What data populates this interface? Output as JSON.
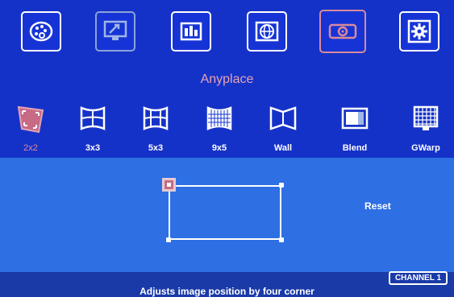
{
  "top_menu": {
    "items": [
      {
        "name": "palette-icon"
      },
      {
        "name": "display-settings-icon"
      },
      {
        "name": "layout-bars-icon"
      },
      {
        "name": "globe-icon"
      },
      {
        "name": "projector-icon",
        "selected": true
      },
      {
        "name": "gear-icon"
      }
    ]
  },
  "section_title": "Anyplace",
  "modes": [
    {
      "label": "2x2",
      "icon": "corner-quad-icon",
      "selected": true
    },
    {
      "label": "3x3",
      "icon": "grid-3x3-icon"
    },
    {
      "label": "5x3",
      "icon": "grid-5x3-icon"
    },
    {
      "label": "9x5",
      "icon": "grid-9x5-icon"
    },
    {
      "label": "Wall",
      "icon": "wall-icon"
    },
    {
      "label": "Blend",
      "icon": "blend-icon"
    },
    {
      "label": "GWarp",
      "icon": "gwarp-icon"
    }
  ],
  "reset_label": "Reset",
  "status_text": "Adjusts image position by four corner",
  "channel_label": "CHANNEL 1",
  "colors": {
    "background": "#1634d6",
    "work_area": "#2e6fe3",
    "accent": "#d98a9a"
  }
}
